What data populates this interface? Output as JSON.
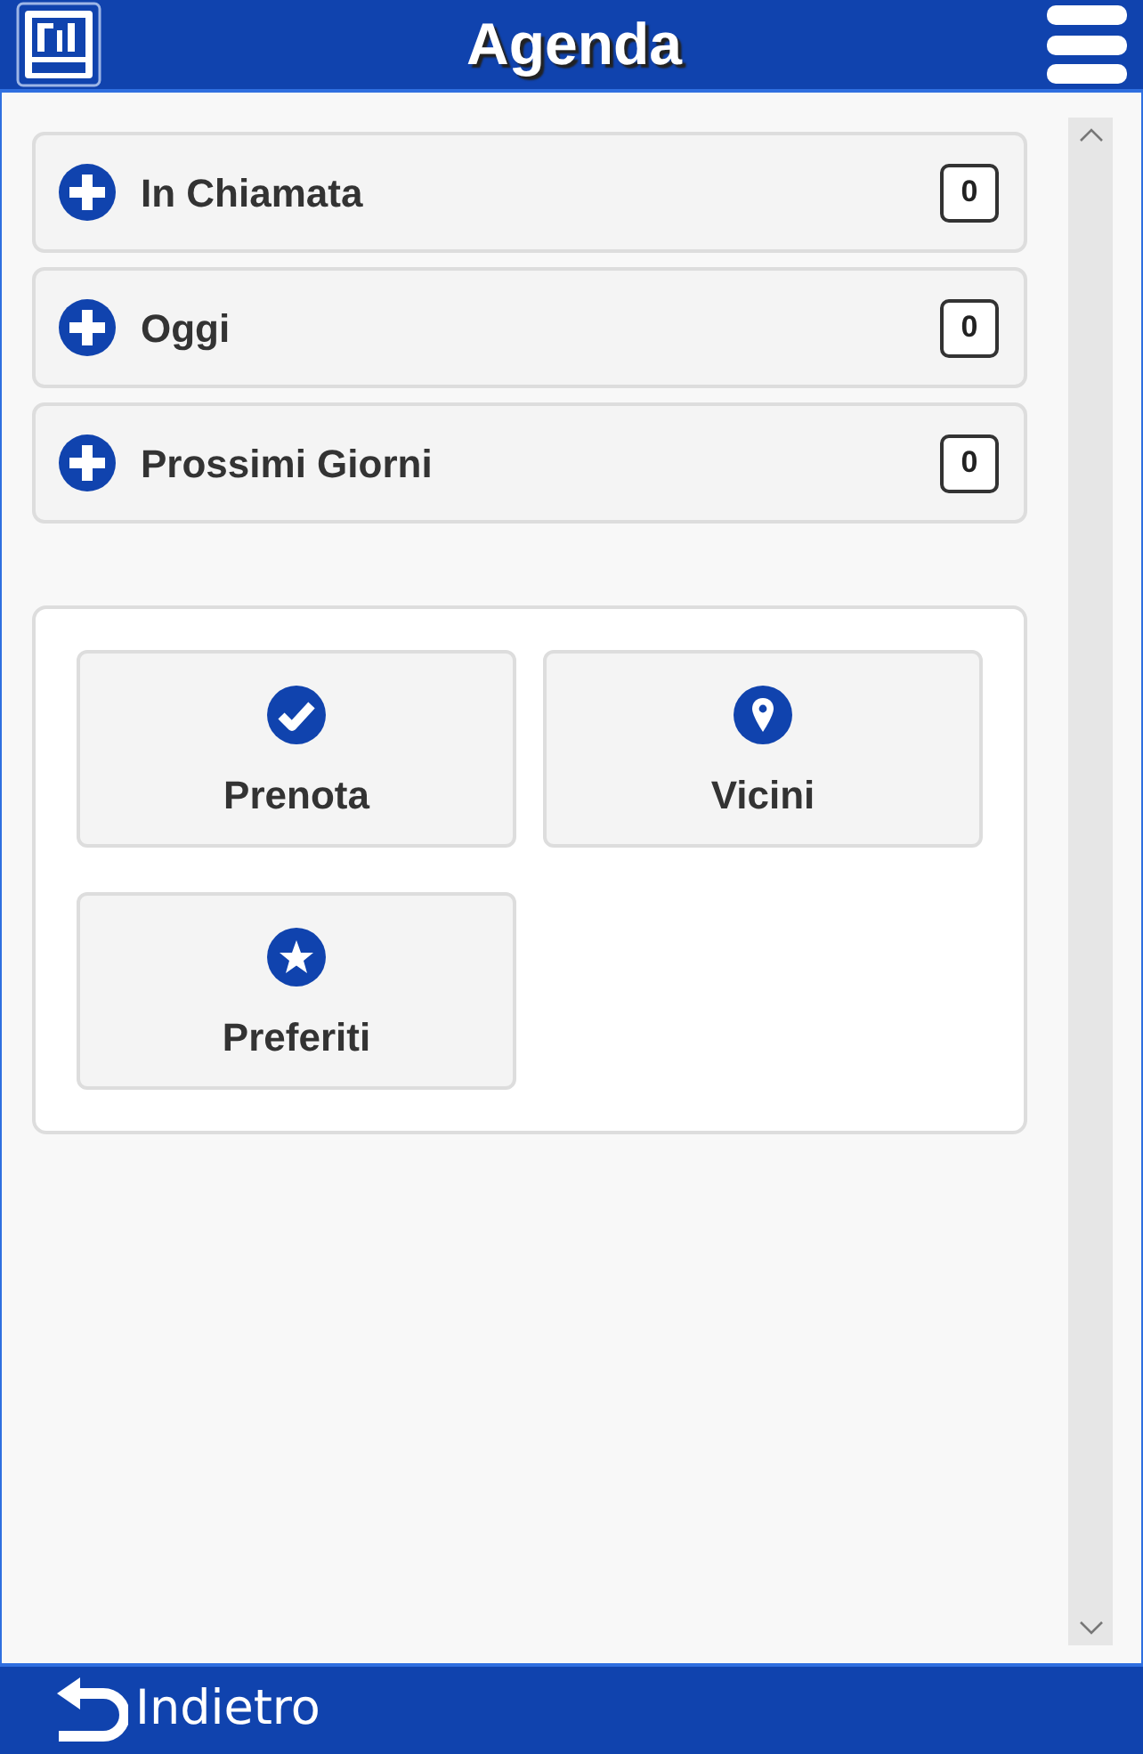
{
  "header": {
    "title": "Agenda"
  },
  "sections": [
    {
      "label": "In Chiamata",
      "count": "0",
      "expanded": false
    },
    {
      "label": "Oggi",
      "count": "0",
      "expanded": false
    },
    {
      "label": "Prossimi Giorni",
      "count": "0",
      "expanded": false
    }
  ],
  "actions": [
    {
      "label": "Prenota",
      "kind": "check"
    },
    {
      "label": "Vicini",
      "kind": "pin"
    },
    {
      "label": "Preferiti",
      "kind": "star"
    }
  ],
  "footer": {
    "back": "Indietro"
  }
}
